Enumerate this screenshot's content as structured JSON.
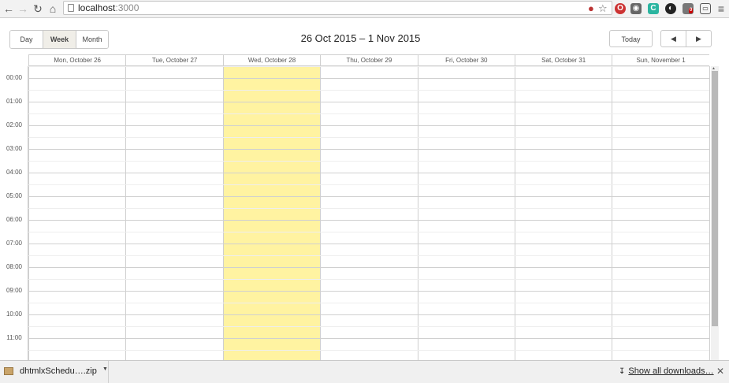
{
  "browser": {
    "url_host": "localhost",
    "url_port": ":3000",
    "icons": {
      "back": "arrow-left-icon",
      "forward": "arrow-right-icon",
      "reload": "reload-icon",
      "home": "home-icon",
      "star": "star-icon",
      "menu": "hamburger-menu-icon"
    },
    "ext_badge": "0",
    "ext_c_label": "C"
  },
  "scheduler": {
    "views": [
      {
        "label": "Day",
        "active": false
      },
      {
        "label": "Week",
        "active": true
      },
      {
        "label": "Month",
        "active": false
      }
    ],
    "date_range": "26 Oct 2015 – 1 Nov 2015",
    "today_label": "Today",
    "prev_label": "◀",
    "next_label": "▶",
    "days": [
      {
        "label": "Mon, October 26",
        "today": false
      },
      {
        "label": "Tue, October 27",
        "today": false
      },
      {
        "label": "Wed, October 28",
        "today": true
      },
      {
        "label": "Thu, October 29",
        "today": false
      },
      {
        "label": "Fri, October 30",
        "today": false
      },
      {
        "label": "Sat, October 31",
        "today": false
      },
      {
        "label": "Sun, November 1",
        "today": false
      }
    ],
    "hours": [
      "00:00",
      "01:00",
      "02:00",
      "03:00",
      "04:00",
      "05:00",
      "06:00",
      "07:00",
      "08:00",
      "09:00",
      "10:00",
      "11:00"
    ],
    "colors": {
      "today_column": "#fff3a1",
      "grid_line": "#d0d0d0"
    }
  },
  "downloads": {
    "file_name": "dhtmlxSchedu….zip",
    "show_all": "Show all downloads…"
  }
}
